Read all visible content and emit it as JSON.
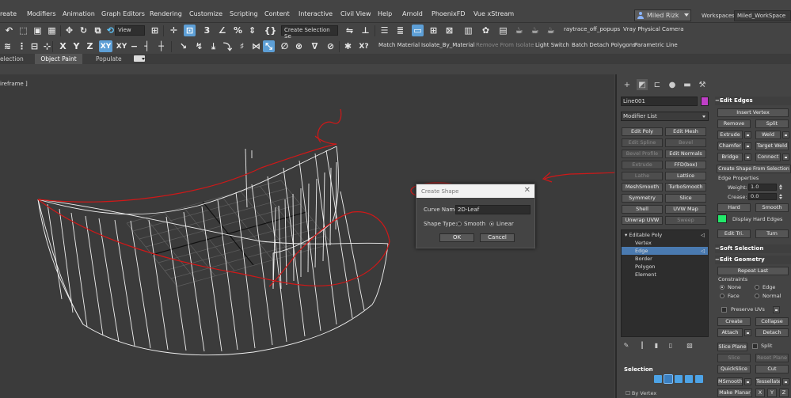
{
  "menu": [
    "reate",
    "Modifiers",
    "Animation",
    "Graph Editors",
    "Rendering",
    "Customize",
    "Scripting",
    "Content",
    "Interactive",
    "Civil View",
    "Help",
    "Arnold",
    "PhoenixFD",
    "Vue xStream"
  ],
  "user": {
    "name": "Miled Rizk",
    "workspaces_label": "Workspaces:",
    "workspace": "Miled_WorkSpace"
  },
  "toolbar1": {
    "view_dropdown": "View",
    "selection_set_dropdown": "Create Selection Se",
    "raytrace_label": "raytrace_off_popups",
    "vray_label": "Vray Physical Camera",
    "icons": [
      "undo-icon",
      "redo-icon",
      "link-icon",
      "unlink-icon",
      "bind-space-warp-icon",
      "select-filter-icon",
      "select-object-icon",
      "select-by-name-icon",
      "rectangle-region-icon",
      "window-crossing-icon",
      "move-icon",
      "rotate-icon",
      "scale-icon",
      "use-pivot-icon",
      "snaps-toggle-icon",
      "angle-snap-icon",
      "percent-snap-icon",
      "spinner-snap-icon",
      "edit-named-selection-icon",
      "mirror-icon",
      "align-icon",
      "toggle-scene-explorer-icon",
      "toggle-layer-explorer-icon",
      "toggle-ribbon-icon",
      "curve-editor-icon",
      "schematic-view-icon",
      "material-editor-icon",
      "render-setup-icon",
      "rendered-frame-window-icon",
      "render-production-icon",
      "render-iterative-icon",
      "render-activeshade-icon"
    ]
  },
  "toolbar2": {
    "axis_labels": [
      "X",
      "Y",
      "Z",
      "XY",
      "XY"
    ],
    "actions": [
      "Match Material",
      "Isolate_By_Material",
      "Remove From Isolate",
      "Light Switch",
      "Batch Detach Polygons",
      "Parametric Line"
    ]
  },
  "ribbon": {
    "tabs": [
      "election",
      "Object Paint",
      "Populate"
    ]
  },
  "viewport": {
    "label": "ireframe ]"
  },
  "dialog": {
    "title": "Create Shape",
    "curve_name_label": "Curve Name:",
    "curve_name_value": "2D-Leaf",
    "shape_type_label": "Shape Type:",
    "smooth_label": "Smooth",
    "linear_label": "Linear",
    "selected_type": "Linear",
    "ok": "OK",
    "cancel": "Cancel"
  },
  "command_panel": {
    "object_name": "Line001",
    "object_color": "#c03fc7",
    "modifier_list": "Modifier List",
    "modifier_buttons": [
      [
        "Edit Poly",
        "Edit Mesh"
      ],
      [
        "Edit Spline",
        "Bevel"
      ],
      [
        "Bevel Profile",
        "Edit Normals"
      ],
      [
        "Extrude",
        "FFD(box)"
      ],
      [
        "Lathe",
        "Lattice"
      ],
      [
        "MeshSmooth",
        "TurboSmooth"
      ],
      [
        "Symmetry",
        "Slice"
      ],
      [
        "Shell",
        "UVW Map"
      ],
      [
        "Unwrap UVW",
        "Sweep"
      ]
    ],
    "disabled_modifiers": [
      "Edit Spline",
      "Bevel",
      "Bevel Profile",
      "Extrude",
      "Lathe",
      "Sweep"
    ],
    "stack": {
      "root": "Editable Poly",
      "items": [
        "Vertex",
        "Edge",
        "Border",
        "Polygon",
        "Element"
      ],
      "selected": "Edge"
    },
    "selection": {
      "title": "Selection",
      "by_vertex": "By Vertex"
    },
    "edit_edges": {
      "title": "Edit Edges",
      "insert_vertex": "Insert Vertex",
      "remove": "Remove",
      "split": "Split",
      "extrude": "Extrude",
      "weld": "Weld",
      "chamfer": "Chamfer",
      "target_weld": "Target Weld",
      "bridge": "Bridge",
      "connect": "Connect",
      "create_shape": "Create Shape From Selection",
      "edge_properties": "Edge Properties",
      "weight_label": "Weight:",
      "weight_value": "1.0",
      "crease_label": "Crease:",
      "crease_value": "0.0",
      "hard": "Hard",
      "smooth": "Smooth",
      "display_hard_edges": "Display Hard Edges",
      "hard_edge_color": "#22e86a",
      "edit_tri": "Edit Tri.",
      "turn": "Turn"
    },
    "soft_selection": {
      "title": "Soft Selection"
    },
    "edit_geometry": {
      "title": "Edit Geometry",
      "repeat_last": "Repeat Last",
      "constraints": "Constraints",
      "none": "None",
      "edge": "Edge",
      "face": "Face",
      "normal": "Normal",
      "selected_constraint": "None",
      "preserve_uvs": "Preserve UVs",
      "create": "Create",
      "collapse": "Collapse",
      "attach": "Attach",
      "detach": "Detach",
      "slice_plane": "Slice Plane",
      "split": "Split",
      "slice": "Slice",
      "reset_plane": "Reset Plane",
      "quickslice": "QuickSlice",
      "cut": "Cut",
      "msmooth": "MSmooth",
      "tessellate": "Tessellate",
      "make_planar": "Make Planar",
      "x": "X",
      "y": "Y",
      "z": "Z"
    }
  },
  "colors": {
    "annotation": "#d01818",
    "viewport_bg": "#3b3b3b",
    "selection_blue": "#4a7ab0"
  }
}
